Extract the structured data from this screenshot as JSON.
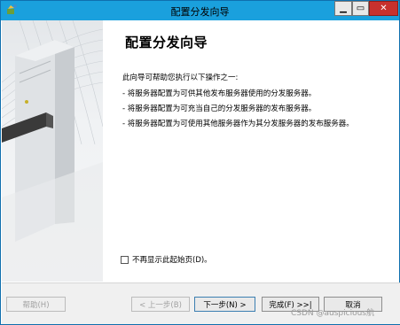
{
  "window": {
    "title": "配置分发向导"
  },
  "titlebar": {
    "minimize_icon": "minimize-icon",
    "maximize_icon": "maximize-icon",
    "close_icon": "close-icon",
    "minimize_glyph": "▁",
    "maximize_glyph": "▭",
    "close_glyph": "✕"
  },
  "content": {
    "heading": "配置分发向导",
    "intro": "此向导可帮助您执行以下操作之一:",
    "bullets": [
      "- 将服务器配置为可供其他发布服务器使用的分发服务器。",
      "- 将服务器配置为可充当自己的分发服务器的发布服务器。",
      "- 将服务器配置为可使用其他服务器作为其分发服务器的发布服务器。"
    ],
    "dont_show_label": "不再显示此起始页(D)。",
    "dont_show_checked": false
  },
  "buttons": {
    "help": "帮助(H)",
    "back": "< 上一步(B)",
    "next": "下一步(N) >",
    "finish": "完成(F) >>|",
    "cancel": "取消"
  },
  "watermark": "CSDN @auspicious航",
  "colors": {
    "titlebar": "#1aa0dd",
    "close_button": "#c7312e",
    "footer": "#f0f0f0"
  }
}
